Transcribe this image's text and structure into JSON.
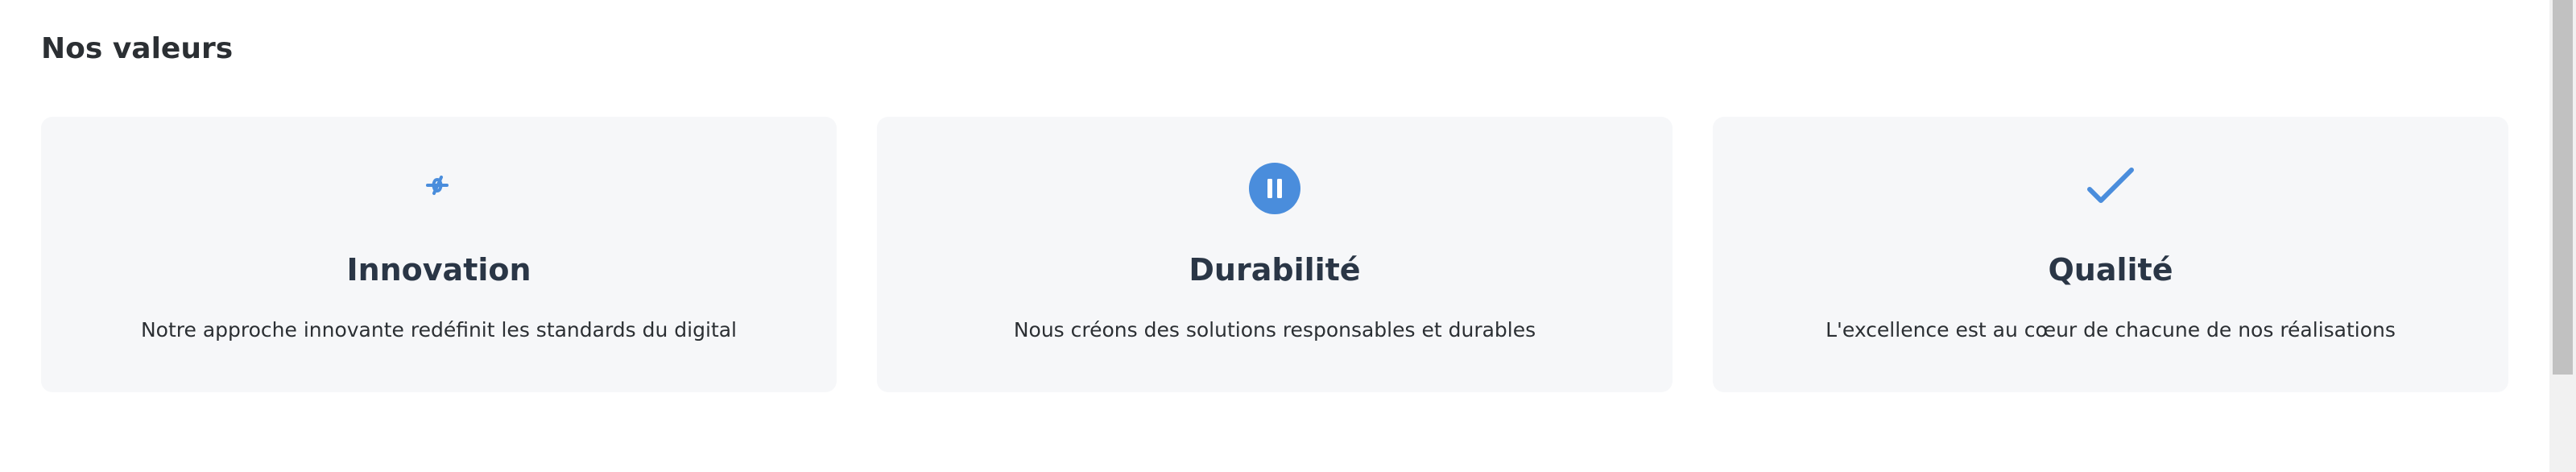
{
  "section": {
    "title": "Nos valeurs"
  },
  "cards": [
    {
      "icon": "lab-icon",
      "title": "Innovation",
      "description": "Notre approche innovante redéfinit les standards du digital"
    },
    {
      "icon": "pause-circle-icon",
      "title": "Durabilité",
      "description": "Nous créons des solutions responsables et durables"
    },
    {
      "icon": "checkmark-icon",
      "title": "Qualité",
      "description": "L'excellence est au cœur de chacune de nos réalisations"
    }
  ],
  "colors": {
    "accent": "#4a8ddc",
    "card_background": "#f6f7f9",
    "heading": "#2a3646"
  }
}
